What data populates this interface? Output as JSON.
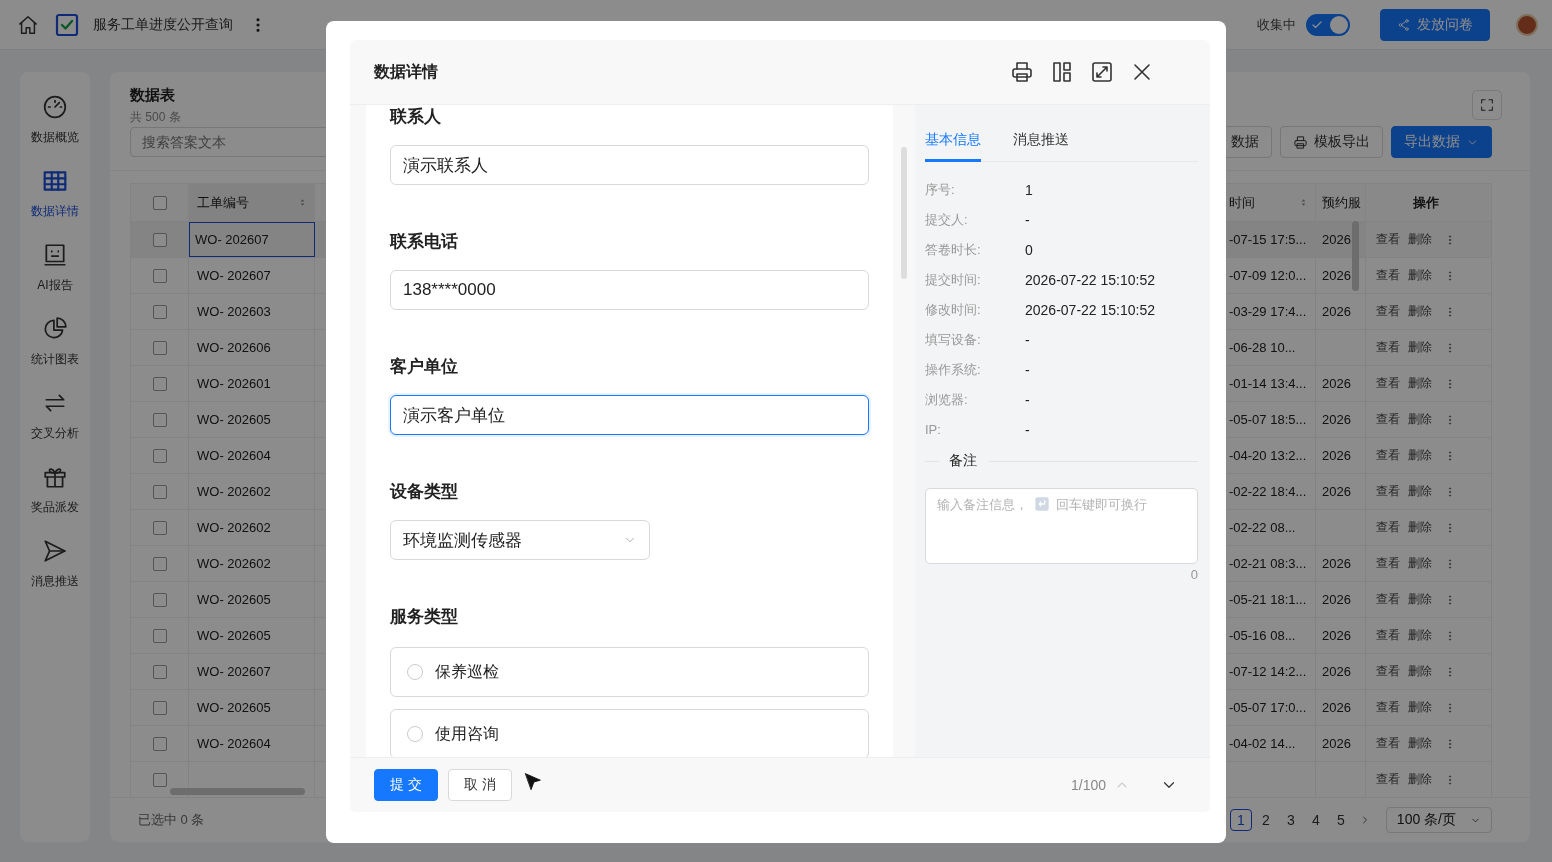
{
  "topbar": {
    "title": "服务工单进度公开查询",
    "status_label": "收集中",
    "collecting": true,
    "publish_button": "发放问卷"
  },
  "sidebar": {
    "items": [
      {
        "kind": "gauge",
        "label": "数据概览",
        "selected": false
      },
      {
        "kind": "grid",
        "label": "数据详情",
        "selected": true
      },
      {
        "kind": "report",
        "label": "AI报告",
        "selected": false
      },
      {
        "kind": "pie",
        "label": "统计图表",
        "selected": false
      },
      {
        "kind": "cross",
        "label": "交叉分析",
        "selected": false
      },
      {
        "kind": "gift",
        "label": "奖品派发",
        "selected": false
      },
      {
        "kind": "send",
        "label": "消息推送",
        "selected": false
      }
    ]
  },
  "table_header": {
    "title": "数据表",
    "count": "共 500 条",
    "search": {
      "placeholder": "搜索答案文本"
    },
    "buttons": [
      {
        "kind": "plain",
        "label": "数据"
      },
      {
        "kind": "print",
        "label": "模板导出"
      },
      {
        "kind": "primary",
        "label": "导出数据"
      }
    ]
  },
  "table": {
    "all_selected": false,
    "columns": [
      {
        "label": "工单编号",
        "sortable": true
      },
      {
        "label": "时间",
        "sortable": true
      },
      {
        "label": "预约服",
        "sortable": false
      },
      {
        "label": "操作",
        "sortable": false
      }
    ],
    "rows": [
      {
        "selected": true,
        "id": "WO- 202607",
        "time": "-07-15 17:5...",
        "column_3": "2026",
        "actions": [
          "查看",
          "删除"
        ]
      },
      {
        "selected": false,
        "id": "WO- 202607",
        "time": "-07-09 12:0...",
        "column_3": "2026",
        "actions": [
          "查看",
          "删除"
        ]
      },
      {
        "selected": false,
        "id": "WO- 202603",
        "time": "-03-29 17:4...",
        "column_3": "2026",
        "actions": [
          "查看",
          "删除"
        ]
      },
      {
        "selected": false,
        "id": "WO- 202606",
        "time": "-06-28 10...",
        "actions": [
          "查看",
          "删除"
        ]
      },
      {
        "selected": false,
        "id": "WO- 202601",
        "time": "-01-14 13:4...",
        "column_3": "2026",
        "actions": [
          "查看",
          "删除"
        ]
      },
      {
        "selected": false,
        "id": "WO- 202605",
        "time": "-05-07 18:5...",
        "column_3": "2026",
        "actions": [
          "查看",
          "删除"
        ]
      },
      {
        "selected": false,
        "id": "WO- 202604",
        "time": "-04-20 13:2...",
        "column_3": "2026",
        "actions": [
          "查看",
          "删除"
        ]
      },
      {
        "selected": false,
        "id": "WO- 202602",
        "time": "-02-22 18:4...",
        "column_3": "2026",
        "actions": [
          "查看",
          "删除"
        ]
      },
      {
        "selected": false,
        "id": "WO- 202602",
        "time": "-02-22 08...",
        "actions": [
          "查看",
          "删除"
        ]
      },
      {
        "selected": false,
        "id": "WO- 202602",
        "time": "-02-21 08:3...",
        "column_3": "2026",
        "actions": [
          "查看",
          "删除"
        ]
      },
      {
        "selected": false,
        "id": "WO- 202605",
        "time": "-05-21 18:1...",
        "column_3": "2026",
        "actions": [
          "查看",
          "删除"
        ]
      },
      {
        "selected": false,
        "id": "WO- 202605",
        "time": "-05-16 08...",
        "column_3": "2026",
        "actions": [
          "查看",
          "删除"
        ]
      },
      {
        "selected": false,
        "id": "WO- 202607",
        "time": "-07-12 14:2...",
        "column_3": "2026",
        "actions": [
          "查看",
          "删除"
        ]
      },
      {
        "selected": false,
        "id": "WO- 202605",
        "time": "-05-07 17:0...",
        "column_3": "2026",
        "actions": [
          "查看",
          "删除"
        ]
      },
      {
        "selected": false,
        "id": "WO- 202604",
        "time": "-04-02 14...",
        "column_3": "2026",
        "actions": [
          "查看",
          "删除"
        ]
      },
      {
        "selected": false,
        "actions": [
          "查看",
          "删除"
        ]
      }
    ]
  },
  "footer": {
    "selected_text": "已选中 0 条",
    "pages": [
      {
        "label": "1",
        "selected": true
      },
      {
        "label": "2",
        "selected": false
      },
      {
        "label": "3",
        "selected": false
      },
      {
        "label": "4",
        "selected": false
      },
      {
        "label": "5",
        "selected": false
      }
    ],
    "page_size": "100 条/页"
  },
  "modal": {
    "title": "数据详情",
    "fields": [
      {
        "kind": "text",
        "label": "联系人",
        "value": "演示联系人",
        "focused": false
      },
      {
        "kind": "text",
        "label": "联系电话",
        "value": "138****0000",
        "focused": false
      },
      {
        "kind": "text",
        "label": "客户单位",
        "value": "演示客户单位",
        "focused": true
      },
      {
        "kind": "select",
        "label": "设备类型",
        "value": "环境监测传感器"
      },
      {
        "kind": "radio",
        "label": "服务类型",
        "options": [
          {
            "label": "保养巡检",
            "selected": false
          },
          {
            "label": "使用咨询",
            "selected": false
          }
        ]
      }
    ],
    "tabs": [
      {
        "label": "基本信息",
        "selected": true
      },
      {
        "label": "消息推送",
        "selected": false
      }
    ],
    "info": [
      {
        "label": "序号:",
        "value": "1"
      },
      {
        "label": "提交人:",
        "value": "-"
      },
      {
        "label": "答卷时长:",
        "value": "0"
      },
      {
        "label": "提交时间:",
        "value": "2026-07-22 15:10:52"
      },
      {
        "label": "修改时间:",
        "value": "2026-07-22 15:10:52"
      },
      {
        "label": "填写设备:",
        "value": "-"
      },
      {
        "label": "操作系统:",
        "value": "-"
      },
      {
        "label": "浏览器:",
        "value": "-"
      },
      {
        "label": "IP:",
        "value": "-"
      }
    ],
    "note": {
      "title": "备注",
      "hint": "输入备注信息，",
      "hint_after": "回车键即可换行",
      "count": "0"
    },
    "submit": "提 交",
    "cancel": "取 消",
    "position": "1/100",
    "previous_disabled": true
  }
}
